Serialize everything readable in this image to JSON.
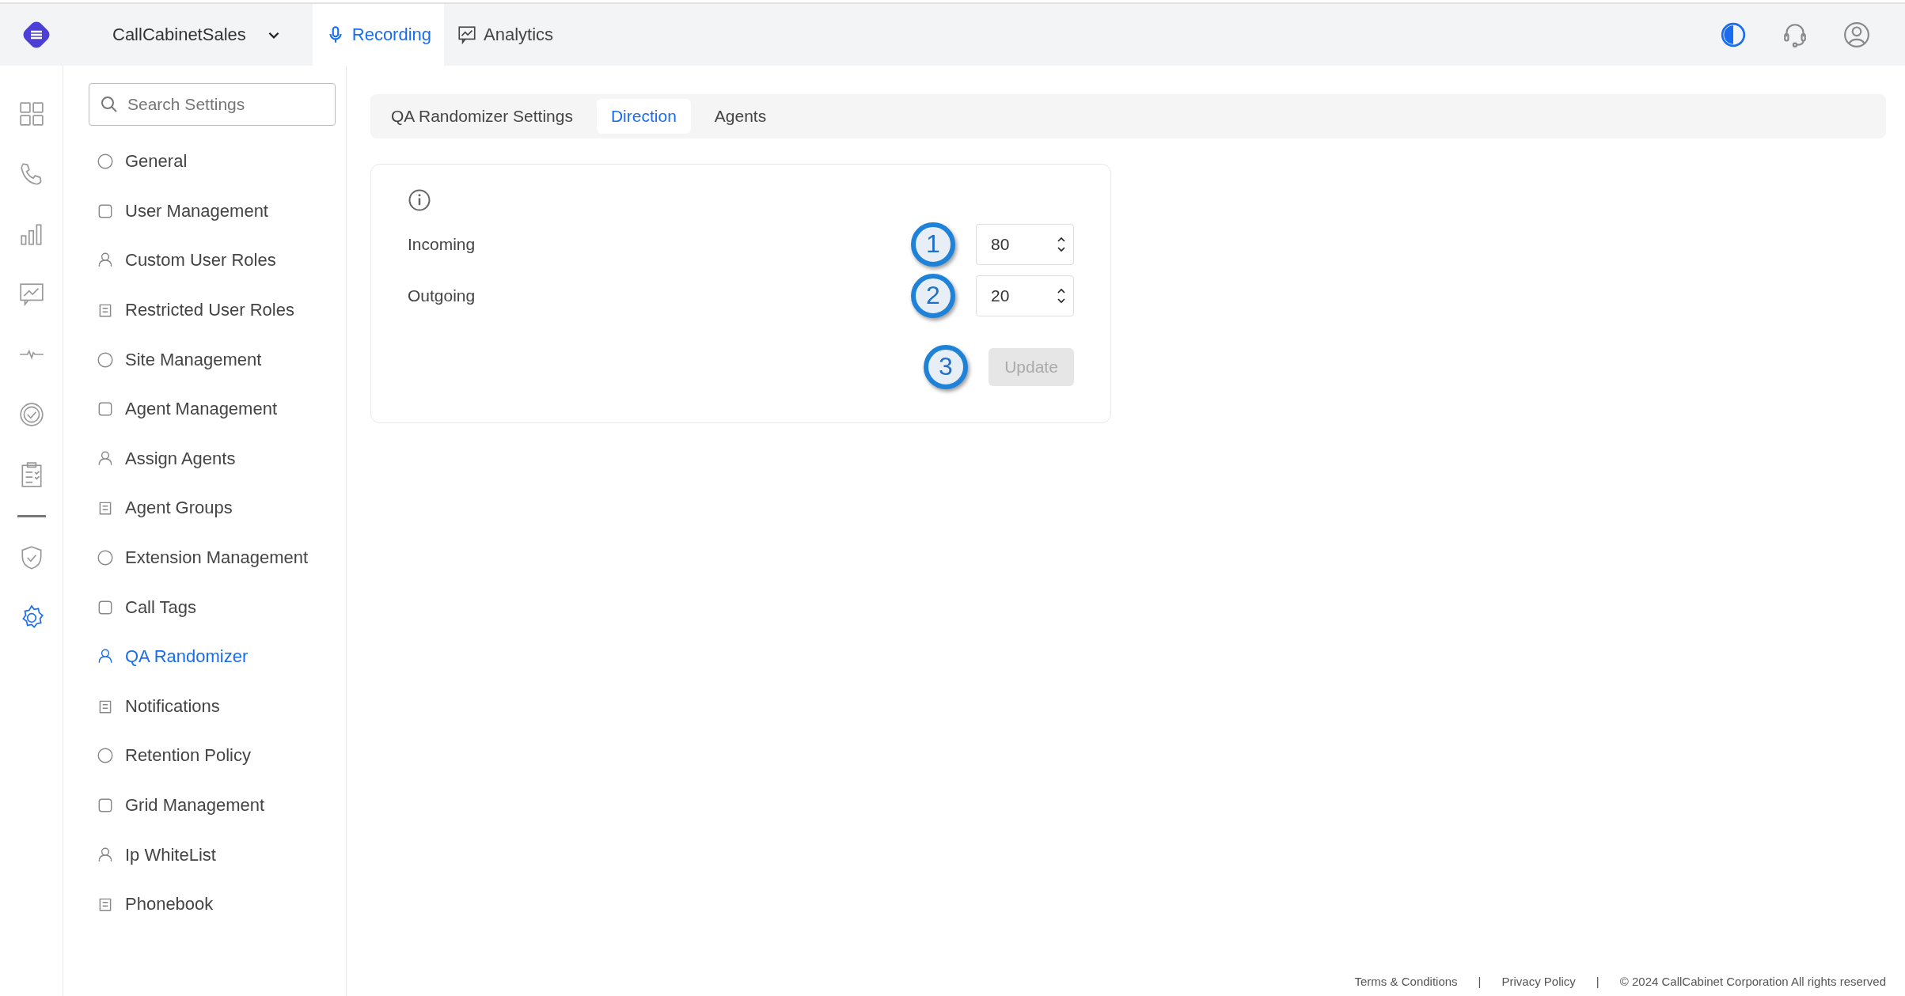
{
  "header": {
    "org": "CallCabinetSales",
    "tabs": [
      {
        "label": "Recording",
        "selected": true
      },
      {
        "label": "Analytics",
        "selected": false
      }
    ]
  },
  "rail": [
    {
      "selected": false
    },
    {
      "selected": false
    },
    {
      "selected": false
    },
    {
      "selected": false
    },
    {
      "selected": false
    },
    {
      "selected": false
    },
    {
      "selected": false
    },
    {
      "selected": false
    },
    {
      "selected": true
    }
  ],
  "sidebar": {
    "search": {
      "placeholder": "Search Settings"
    },
    "items": [
      {
        "label": "General",
        "selected": false
      },
      {
        "label": "User Management",
        "selected": false
      },
      {
        "label": "Custom User Roles",
        "selected": false
      },
      {
        "label": "Restricted User Roles",
        "selected": false
      },
      {
        "label": "Site Management",
        "selected": false
      },
      {
        "label": "Agent Management",
        "selected": false
      },
      {
        "label": "Assign Agents",
        "selected": false
      },
      {
        "label": "Agent Groups",
        "selected": false
      },
      {
        "label": "Extension Management",
        "selected": false
      },
      {
        "label": "Call Tags",
        "selected": false
      },
      {
        "label": "QA Randomizer",
        "selected": true
      },
      {
        "label": "Notifications",
        "selected": false
      },
      {
        "label": "Retention Policy",
        "selected": false
      },
      {
        "label": "Grid Management",
        "selected": false
      },
      {
        "label": "Ip WhiteList",
        "selected": false
      },
      {
        "label": "Phonebook",
        "selected": false
      }
    ]
  },
  "tabs": [
    {
      "label": "QA Randomizer Settings",
      "selected": false
    },
    {
      "label": "Direction",
      "selected": true
    },
    {
      "label": "Agents",
      "selected": false
    }
  ],
  "form": {
    "fields": [
      {
        "label": "Incoming",
        "value": "80",
        "callout": "1"
      },
      {
        "label": "Outgoing",
        "value": "20",
        "callout": "2"
      }
    ],
    "button": {
      "label": "Update",
      "disabled": true,
      "callout": "3"
    }
  },
  "footer": {
    "links": [
      "Terms & Conditions",
      "Privacy Policy"
    ],
    "separators": [
      "|",
      "|"
    ],
    "copyright": "© 2024 CallCabinet Corporation All rights reserved"
  }
}
